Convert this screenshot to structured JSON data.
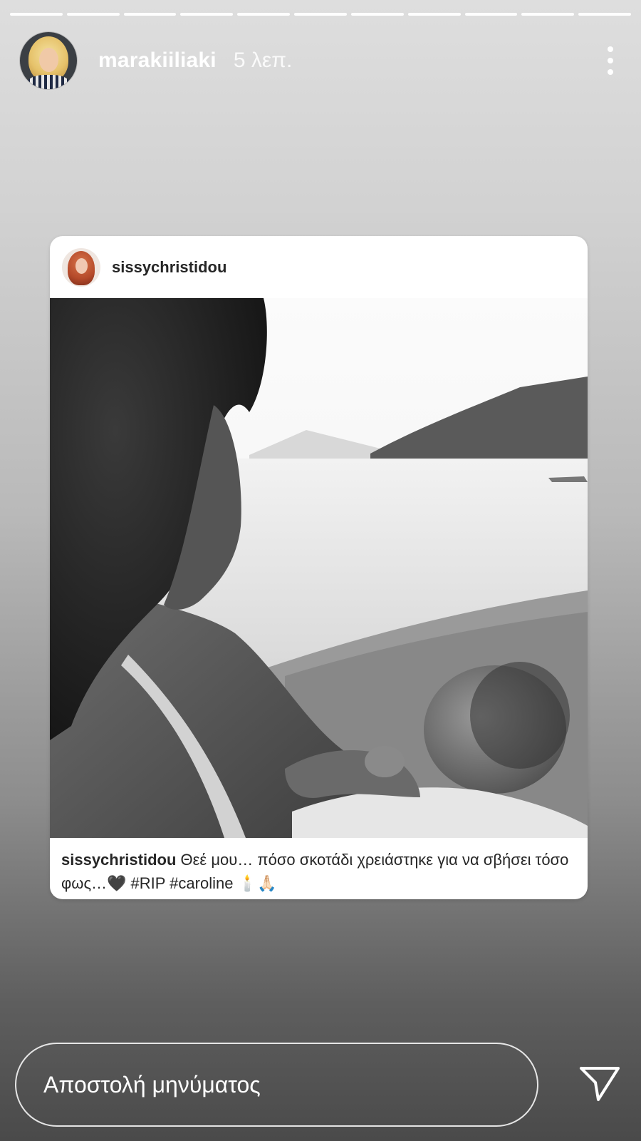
{
  "story": {
    "progress_segments": 11,
    "username": "marakiiliaki",
    "time": "5 λεπ."
  },
  "shared_post": {
    "username": "sissychristidou",
    "caption_user": "sissychristidou",
    "caption_text": "Θεέ μου… πόσο σκοτάδι χρειάστηκε για να σβήσει τόσο φως…🖤 #RIP #caroline 🕯️🙏🏻"
  },
  "reply": {
    "placeholder": "Αποστολή μηνύματος"
  },
  "icons": {
    "more": "more-options-icon",
    "send": "send-icon"
  }
}
